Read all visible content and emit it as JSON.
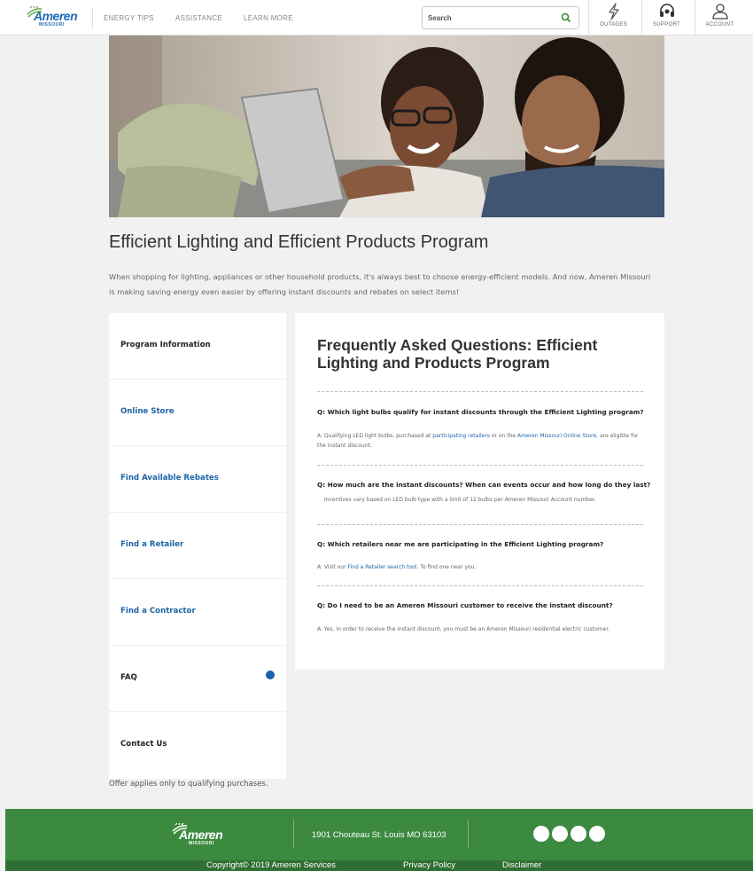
{
  "header": {
    "logo_text": "Ameren",
    "logo_sub": "MISSOURI",
    "nav": [
      "ENERGY TIPS",
      "ASSISTANCE",
      "LEARN MORE"
    ],
    "search_placeholder": "Search",
    "utilities": [
      {
        "label": "OUTAGES",
        "icon": "lightning-icon"
      },
      {
        "label": "SUPPORT",
        "icon": "headset-icon"
      },
      {
        "label": "ACCOUNT",
        "icon": "user-icon"
      }
    ]
  },
  "page": {
    "title": "Efficient Lighting and Efficient Products Program",
    "intro": "When shopping for lighting, appliances or other household products, it's always best to choose energy-efficient models. And now, Ameren Missouri is making saving energy even easier by offering instant discounts and rebates on select items!"
  },
  "sidenav": {
    "items": [
      {
        "label": "Program Information",
        "style": "dark"
      },
      {
        "label": "Online Store",
        "style": "blue"
      },
      {
        "label": "Find Available Rebates",
        "style": "blue"
      },
      {
        "label": "Find a Retailer",
        "style": "blue"
      },
      {
        "label": "Find a Contractor",
        "style": "blue"
      },
      {
        "label": "FAQ",
        "style": "dark",
        "active": true
      },
      {
        "label": "Contact Us",
        "style": "dark"
      }
    ],
    "offer_note": "Offer applies only to qualifying purchases."
  },
  "faq": {
    "title": "Frequently Asked Questions: Efficient Lighting and Products Program",
    "items": [
      {
        "q": "Q: Which light bulbs qualify for instant discounts through the Efficient Lighting program?",
        "a_pre": "A: Qualifying LED light bulbs, purchased at ",
        "a_link1": "participating retailers",
        "a_mid": " or on the ",
        "a_link2": "Ameren Missouri Online Store",
        "a_post": ", are eligible for the instant discount."
      },
      {
        "q": "Q: How much are the instant discounts? When can events occur and how long do they last?",
        "a": "Incentives vary based on LED bulb type with a limit of 12 bulbs per Ameren Missouri Account number."
      },
      {
        "q": "Q: Which retailers near me are participating in the Efficient Lighting program?",
        "a_pre": "A: Visit our ",
        "a_link1": "Find a Retailer search tool",
        "a_post": ". To find one near you."
      },
      {
        "q": "Q: Do I need to be an Ameren Missouri customer to receive the instant discount?",
        "a": "A: Yes. In order to receive the instant discount, you must be an Ameren Missouri residential electric customer."
      }
    ]
  },
  "footer": {
    "logo_text": "Ameren",
    "logo_sub": "MISSOURI",
    "address": "1901 Chouteau  St. Louis  MO 63103",
    "copyright": "Copyright© 2019 Ameren Services",
    "privacy": "Privacy Policy",
    "disclaimer": "Disclaimer"
  },
  "colors": {
    "brand_blue": "#1d64a8",
    "footer_green": "#3b8a3f",
    "active_dot": "#1f5fa8"
  }
}
